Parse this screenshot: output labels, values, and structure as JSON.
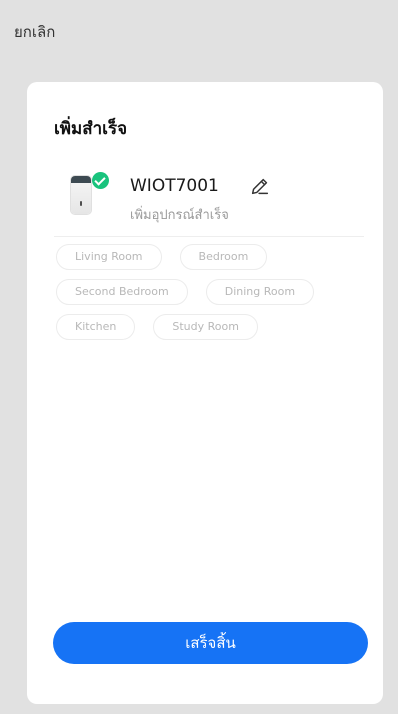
{
  "header": {
    "cancel_label": "ยกเลิก"
  },
  "card": {
    "title": "เพิ่มสำเร็จ",
    "device": {
      "name": "WIOT7001",
      "status": "เพิ่มอุปกรณ์สำเร็จ",
      "status_icon": "check-circle-icon",
      "edit_icon": "pencil-icon"
    },
    "rooms": [
      [
        "Living Room",
        "Bedroom"
      ],
      [
        "Second Bedroom",
        "Dining Room"
      ],
      [
        "Kitchen",
        "Study Room"
      ]
    ],
    "done_label": "เสร็จสิ้น"
  },
  "colors": {
    "accent": "#1673f5",
    "success": "#19c37d",
    "backdrop": "#e1e1e1"
  }
}
